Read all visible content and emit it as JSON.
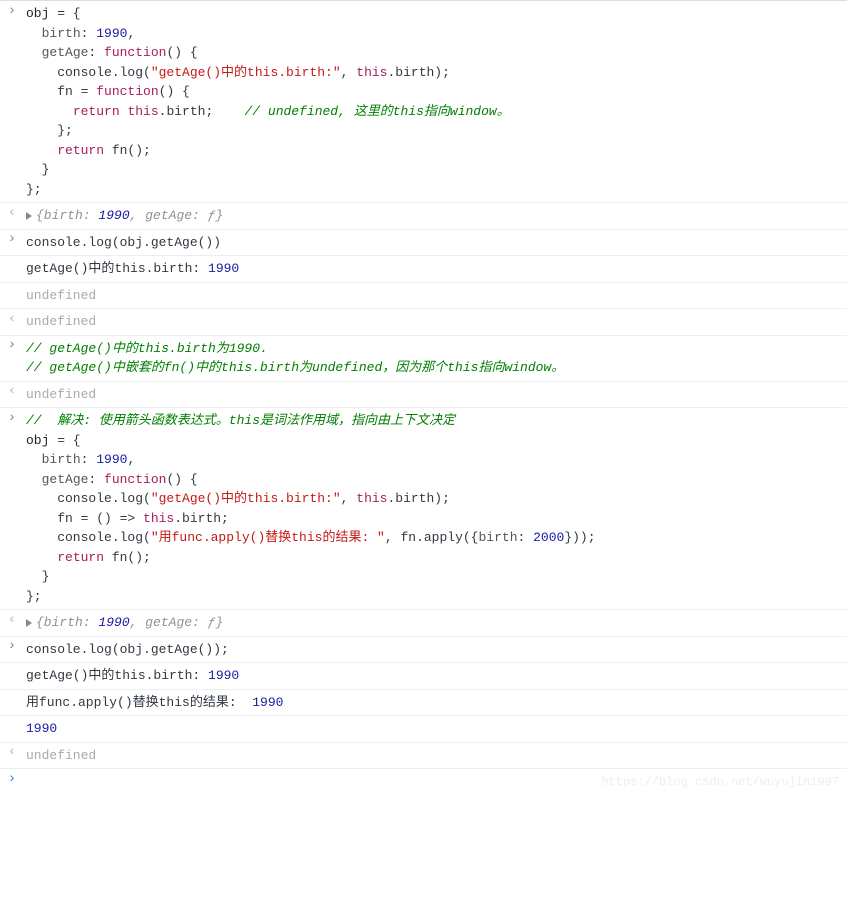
{
  "entries": [
    {
      "kind": "input",
      "html": "<span class='obj'>obj</span> = {<br>&nbsp;&nbsp;<span class='prop'>birth</span>: <span class='num'>1990</span>,<br>&nbsp;&nbsp;<span class='prop'>getAge</span>: <span class='kw'>function</span>() {<br>&nbsp;&nbsp;&nbsp;&nbsp;console.log(<span class='str'>\"getAge()中的this.birth:\"</span>, <span class='kw'>this</span>.birth);<br>&nbsp;&nbsp;&nbsp;&nbsp;fn = <span class='kw'>function</span>() {<br>&nbsp;&nbsp;&nbsp;&nbsp;&nbsp;&nbsp;<span class='kw'>return</span> <span class='kw'>this</span>.birth;&nbsp;&nbsp;&nbsp;&nbsp;<span class='comment'>// undefined, 这里的this指向window。</span><br>&nbsp;&nbsp;&nbsp;&nbsp;};<br>&nbsp;&nbsp;&nbsp;&nbsp;<span class='kw'>return</span> fn();<br>&nbsp;&nbsp;}<br>};"
    },
    {
      "kind": "output-object",
      "text": "{birth: 1990, getAge: ƒ}"
    },
    {
      "kind": "input",
      "html": "console.log(obj.getAge())"
    },
    {
      "kind": "log",
      "html": "getAge()中的this.birth: <span class='num'>1990</span>"
    },
    {
      "kind": "log",
      "html": "<span class='undef'>undefined</span>"
    },
    {
      "kind": "output-undef",
      "text": "undefined"
    },
    {
      "kind": "input",
      "html": "<span class='comment'>// getAge()中的this.birth为1990.</span><br><span class='comment'>// getAge()中嵌套的fn()中的this.birth为undefined，因为那个this指向window。</span>"
    },
    {
      "kind": "output-undef",
      "text": "undefined"
    },
    {
      "kind": "input",
      "html": "<span class='comment'>//&nbsp;&nbsp;解决: 使用箭头函数表达式。this是词法作用域，指向由上下文决定</span><br><span class='obj'>obj</span> = {<br>&nbsp;&nbsp;<span class='prop'>birth</span>: <span class='num'>1990</span>,<br>&nbsp;&nbsp;<span class='prop'>getAge</span>: <span class='kw'>function</span>() {<br>&nbsp;&nbsp;&nbsp;&nbsp;console.log(<span class='str'>\"getAge()中的this.birth:\"</span>, <span class='kw'>this</span>.birth);<br>&nbsp;&nbsp;&nbsp;&nbsp;fn = () =&gt; <span class='kw'>this</span>.birth;<br>&nbsp;&nbsp;&nbsp;&nbsp;console.log(<span class='str'>\"用func.apply()替换this的结果: \"</span>, fn.apply({<span class='prop'>birth</span>: <span class='num'>2000</span>}));<br>&nbsp;&nbsp;&nbsp;&nbsp;<span class='kw'>return</span> fn();<br>&nbsp;&nbsp;}<br>};"
    },
    {
      "kind": "output-object",
      "text": "{birth: 1990, getAge: ƒ}"
    },
    {
      "kind": "input",
      "html": "console.log(obj.getAge());"
    },
    {
      "kind": "log",
      "html": "getAge()中的this.birth: <span class='num'>1990</span>"
    },
    {
      "kind": "log",
      "html": "用func.apply()替换this的结果: &nbsp;<span class='num'>1990</span>"
    },
    {
      "kind": "log",
      "html": "<span class='num'>1990</span>"
    },
    {
      "kind": "output-undef",
      "text": "undefined"
    }
  ],
  "watermark": "https://blog.csdn.net/wuyujin1997"
}
